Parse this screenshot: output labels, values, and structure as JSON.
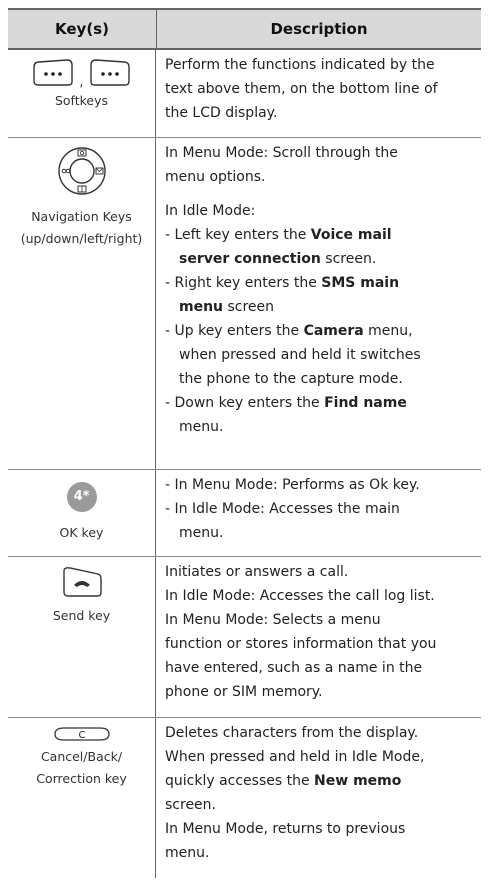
{
  "header": {
    "col_keys": "Key(s)",
    "col_desc": "Description"
  },
  "rows": [
    {
      "icon": "softkey-icon",
      "comma": ",",
      "key_label": "Softkeys",
      "lines": [
        "Perform the functions indicated by the",
        "text above them, on the bottom line of",
        "the LCD display."
      ]
    },
    {
      "icon": "navigation-keys-icon",
      "key_label_1": "Navigation Keys",
      "key_label_2": "(up/down/left/right)",
      "menu_lines": [
        "In Menu Mode: Scroll through the",
        "menu options."
      ],
      "idle_title": "In Idle Mode:",
      "b1": {
        "pre": "- Left key enters the ",
        "bold1": "Voice mail",
        "bold2": "server connection",
        "post": " screen."
      },
      "b2": {
        "pre": "- Right key enters the ",
        "bold1": "SMS main",
        "bold2": "menu",
        "post": " screen"
      },
      "b3": {
        "pre": "- Up key enters the ",
        "bold": "Camera",
        "post": " menu,",
        "l2": "when pressed and held it switches",
        "l3": "the phone to the capture mode."
      },
      "b4": {
        "pre": "- Down key enters the ",
        "bold": "Find name",
        "l2": "menu."
      }
    },
    {
      "icon": "ok-key-icon",
      "icon_glyph": "4*",
      "key_label": "OK key",
      "lines": [
        "- In Menu Mode: Performs as Ok key.",
        "- In Idle Mode: Accesses the main",
        "menu."
      ]
    },
    {
      "icon": "send-key-icon",
      "key_label": "Send key",
      "lines": [
        "Initiates or answers a call.",
        "In Idle Mode: Accesses the call log list.",
        "In Menu Mode: Selects a menu",
        "function or stores information that you",
        "have entered, such as a name in the",
        "phone or SIM memory."
      ]
    },
    {
      "icon": "cancel-key-icon",
      "icon_glyph": "C",
      "key_label_1": "Cancel/Back/",
      "key_label_2": "Correction key",
      "lines": [
        "Deletes characters from the display.",
        "When pressed and held in Idle Mode,"
      ],
      "l3_pre": "quickly accesses the ",
      "l3_bold": "New memo",
      "l4": "screen.",
      "l5": "In Menu Mode, returns to previous",
      "l6": "menu."
    }
  ]
}
